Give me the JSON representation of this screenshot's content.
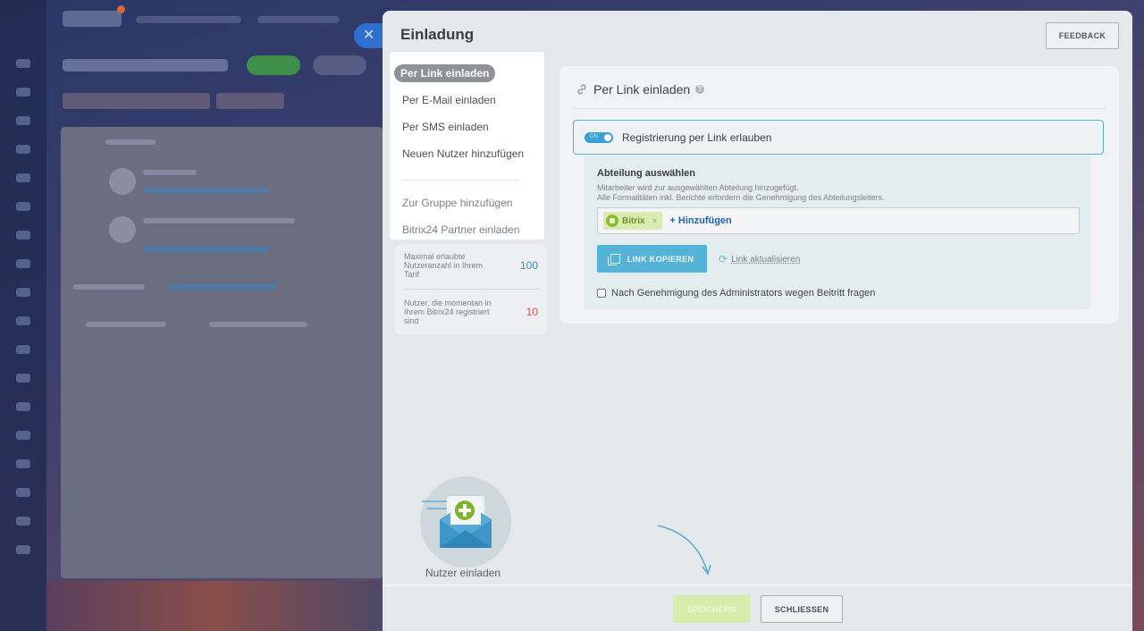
{
  "panel": {
    "title": "Einladung",
    "feedback_label": "FEEDBACK",
    "close_tab_icon": "close-icon"
  },
  "menu": {
    "items": [
      {
        "label": "Per Link einladen",
        "active": true
      },
      {
        "label": "Per E-Mail einladen"
      },
      {
        "label": "Per SMS einladen"
      },
      {
        "label": "Neuen Nutzer hinzufügen"
      }
    ],
    "secondary": [
      {
        "label": "Zur Gruppe hinzufügen"
      },
      {
        "label": "Bitrix24 Partner einladen"
      }
    ]
  },
  "stats": [
    {
      "label": "Maximal erlaubte Nutzeranzahl in Ihrem Tarif",
      "value": "100",
      "color": "#3a8fc7"
    },
    {
      "label": "Nutzer, die momentan in Ihrem Bitrix24 registriert sind",
      "value": "10",
      "color": "#e0554d"
    }
  ],
  "content": {
    "title": "Per Link einladen",
    "toggle": {
      "label": "Registrierung per Link erlauben",
      "state_text": "ON",
      "enabled": true
    },
    "department": {
      "title": "Abteilung auswählen",
      "desc_line1": "Mitarbeiter wird zur ausgewählten Abteilung hinzugefügt.",
      "desc_line2": "Alle Formalitäten inkl. Berichte erfordern die Genehmigung des Abteilungsleiters.",
      "chip": "Bitrix",
      "chip_remove": "×",
      "add_label": "+ Hinzufügen"
    },
    "copy_label": "LINK KOPIEREN",
    "refresh_label": "Link aktualisieren",
    "approval_label": "Nach Genehmigung des Administrators wegen Beitritt fragen"
  },
  "illustration": {
    "caption": "Nutzer einladen"
  },
  "footer": {
    "save_label": "SPEICHERN",
    "close_label": "SCHLIESSEN"
  },
  "colors": {
    "accent": "#55b3d8",
    "save": "#d5ecaa",
    "chip": "#8dbb2c",
    "link": "#2066b0"
  }
}
